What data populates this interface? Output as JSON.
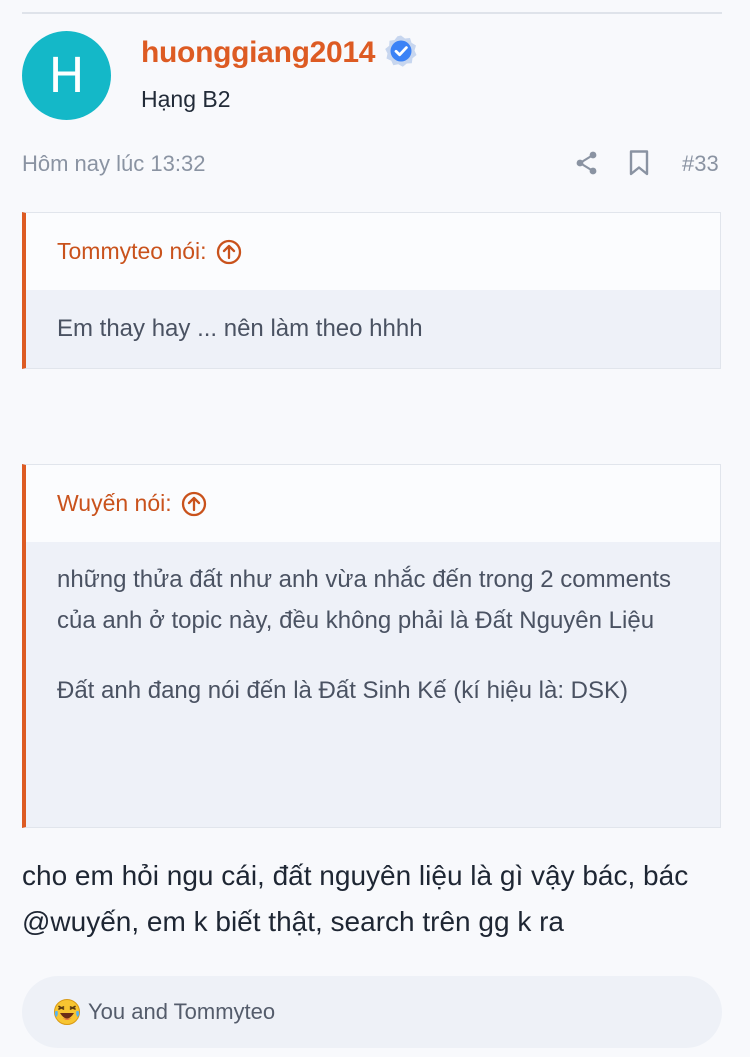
{
  "post": {
    "author": {
      "avatar_letter": "H",
      "avatar_color": "#14b8c8",
      "username": "huonggiang2014",
      "verified_icon": "verified-badge-icon",
      "rank": "Hạng B2"
    },
    "timestamp": "Hôm nay lúc 13:32",
    "actions": {
      "share_icon": "share-icon",
      "bookmark_icon": "bookmark-icon"
    },
    "number": "#33",
    "quotes": [
      {
        "author_label": "Tommyteo nói:",
        "paragraphs": [
          "Em thay hay ... nên làm theo hhhh"
        ]
      },
      {
        "author_label": "Wuyến nói:",
        "paragraphs": [
          "những thửa đất như anh vừa nhắc đến trong 2 comments của anh ở topic này, đều không phải là Đất Nguyên Liệu",
          "Đất anh đang nói đến là Đất Sinh Kế (kí hiệu là: DSK)"
        ]
      }
    ],
    "message": "cho em hỏi ngu cái, đất nguyên liệu là gì vậy bác, bác @wuyến, em k biết thật, search trên gg k ra",
    "reactions": {
      "icon": "laughing-emoji-icon",
      "text": "You and Tommyteo"
    }
  },
  "colors": {
    "accent": "#dd5b23",
    "quote_border": "#dd5b23",
    "verified": "#3b82f6"
  }
}
